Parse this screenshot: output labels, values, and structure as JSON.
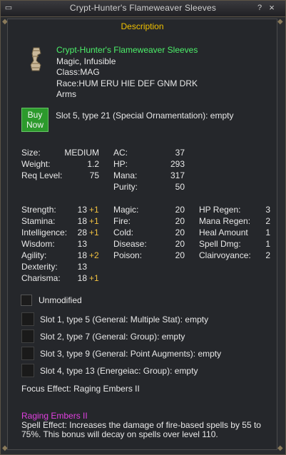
{
  "window": {
    "title": "Crypt-Hunter's Flameweaver Sleeves",
    "help_glyph": "?",
    "close_glyph": "×",
    "menu_glyph": "▭"
  },
  "description": {
    "header": "Description"
  },
  "item": {
    "name": "Crypt-Hunter's Flameweaver Sleeves",
    "lines": [
      "Magic, Infusible",
      "Class:MAG",
      "Race:HUM ERU HIE DEF GNM DRK",
      "Arms"
    ],
    "icon": "sleeve-icon"
  },
  "buy_button": {
    "label_line1": "Buy",
    "label_line2": "Now"
  },
  "slot5": "Slot 5, type 21 (Special Ornamentation): empty",
  "stats_basic": [
    {
      "label": "Size:",
      "value": "MEDIUM"
    },
    {
      "label": "Weight:",
      "value": "1.2"
    },
    {
      "label": "Req Level:",
      "value": "75"
    }
  ],
  "stats_defense": [
    {
      "label": "AC:",
      "value": "37"
    },
    {
      "label": "HP:",
      "value": "293"
    },
    {
      "label": "Mana:",
      "value": "317"
    },
    {
      "label": "Purity:",
      "value": "50"
    }
  ],
  "attributes": [
    {
      "label": "Strength:",
      "value": "13",
      "bonus": "+1"
    },
    {
      "label": "Stamina:",
      "value": "18",
      "bonus": "+1"
    },
    {
      "label": "Intelligence:",
      "value": "28",
      "bonus": "+1"
    },
    {
      "label": "Wisdom:",
      "value": "13",
      "bonus": ""
    },
    {
      "label": "Agility:",
      "value": "18",
      "bonus": "+2"
    },
    {
      "label": "Dexterity:",
      "value": "13",
      "bonus": ""
    },
    {
      "label": "Charisma:",
      "value": "18",
      "bonus": "+1"
    }
  ],
  "resists": [
    {
      "label": "Magic:",
      "value": "20"
    },
    {
      "label": "Fire:",
      "value": "20"
    },
    {
      "label": "Cold:",
      "value": "20"
    },
    {
      "label": "Disease:",
      "value": "20"
    },
    {
      "label": "Poison:",
      "value": "20"
    }
  ],
  "mods": [
    {
      "label": "HP Regen:",
      "value": "3"
    },
    {
      "label": "Mana Regen:",
      "value": "2"
    },
    {
      "label": "Heal Amount",
      "value": "1"
    },
    {
      "label": "Spell Dmg:",
      "value": "1"
    },
    {
      "label": "Clairvoyance:",
      "value": "2"
    }
  ],
  "unmodified_label": "Unmodified",
  "aug_slots": [
    "Slot 1, type 5 (General: Multiple Stat): empty",
    "Slot 2, type 7 (General: Group): empty",
    "Slot 3, type 9 (General: Point Augments): empty",
    "Slot 4, type 13 (Energeiac: Group): empty"
  ],
  "focus_effect": "Focus Effect: Raging Embers II",
  "focus": {
    "name": "Raging Embers II",
    "description_line1": "Spell Effect: Increases the damage of fire-based spells by 55 to",
    "description_line2": "75%. This bonus will decay on spells over level 110."
  },
  "colors": {
    "item_name": "#4cf06a",
    "header": "#f0c000",
    "bonus": "#f0c040",
    "focus_name": "#e040e0",
    "buy_button": "#2c9a2c"
  }
}
